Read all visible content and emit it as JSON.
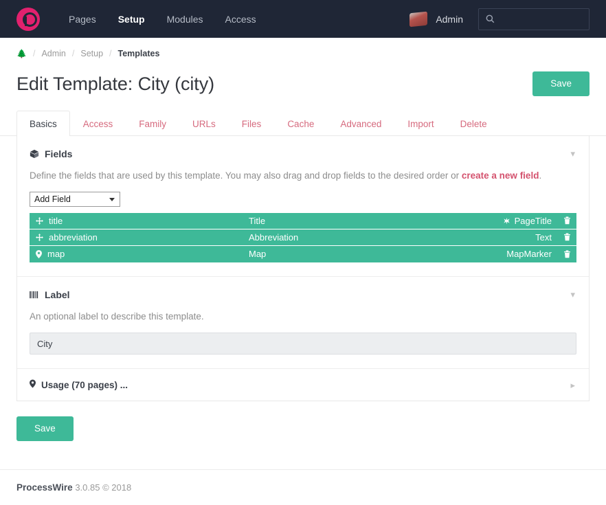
{
  "masthead": {
    "logo_icon": "processwire-logo",
    "nav": [
      {
        "label": "Pages",
        "active": false
      },
      {
        "label": "Setup",
        "active": true
      },
      {
        "label": "Modules",
        "active": false
      },
      {
        "label": "Access",
        "active": false
      }
    ],
    "user": {
      "label": "Admin",
      "avatar_icon": "user-avatar"
    },
    "search": {
      "icon": "search-icon",
      "value": "",
      "placeholder": ""
    },
    "bg_color": "#1f2636"
  },
  "breadcrumb": {
    "home_icon": "tree-icon",
    "items": [
      {
        "label": "Admin",
        "current": false
      },
      {
        "label": "Setup",
        "current": false
      },
      {
        "label": "Templates",
        "current": true
      }
    ],
    "separator": "/"
  },
  "page": {
    "title": "Edit Template: City (city)",
    "save_top_label": "Save",
    "save_bottom_label": "Save"
  },
  "tabs": [
    {
      "label": "Basics",
      "active": true
    },
    {
      "label": "Access",
      "active": false
    },
    {
      "label": "Family",
      "active": false
    },
    {
      "label": "URLs",
      "active": false
    },
    {
      "label": "Files",
      "active": false
    },
    {
      "label": "Cache",
      "active": false
    },
    {
      "label": "Advanced",
      "active": false
    },
    {
      "label": "Import",
      "active": false
    },
    {
      "label": "Delete",
      "active": false
    }
  ],
  "fields_section": {
    "icon": "cube-icon",
    "title": "Fields",
    "collapse_icon": "chevron-down-icon",
    "description_before": "Define the fields that are used by this template. You may also drag and drop fields to the desired order or ",
    "description_link": "create a new field",
    "description_after": ".",
    "add_field": {
      "label": "Add Field",
      "caret_icon": "chevron-down-icon"
    },
    "rows": [
      {
        "handle_icon": "move-icon",
        "name": "title",
        "label": "Title",
        "type_icon": "asterisk-icon",
        "type": "PageTitle",
        "delete_icon": "trash-icon"
      },
      {
        "handle_icon": "move-icon",
        "name": "abbreviation",
        "label": "Abbreviation",
        "type_icon": "",
        "type": "Text",
        "delete_icon": "trash-icon"
      },
      {
        "handle_icon": "map-marker-icon",
        "name": "map",
        "label": "Map",
        "type_icon": "",
        "type": "MapMarker",
        "delete_icon": "trash-icon"
      }
    ],
    "row_color": "#3eb998"
  },
  "label_section": {
    "icon": "barcode-icon",
    "title": "Label",
    "collapse_icon": "chevron-down-icon",
    "description": "An optional label to describe this template.",
    "input_value": "City",
    "input_placeholder": ""
  },
  "usage_section": {
    "icon": "map-marker-icon",
    "title": "Usage (70 pages) ...",
    "collapse_icon": "chevron-right-icon"
  },
  "footer": {
    "brand": "ProcessWire",
    "version": "3.0.85 © 2018"
  },
  "colors": {
    "accent_green": "#3eb998",
    "accent_pink": "#d66a7e",
    "brand_magenta": "#e2216e",
    "header_bg": "#1f2636"
  }
}
